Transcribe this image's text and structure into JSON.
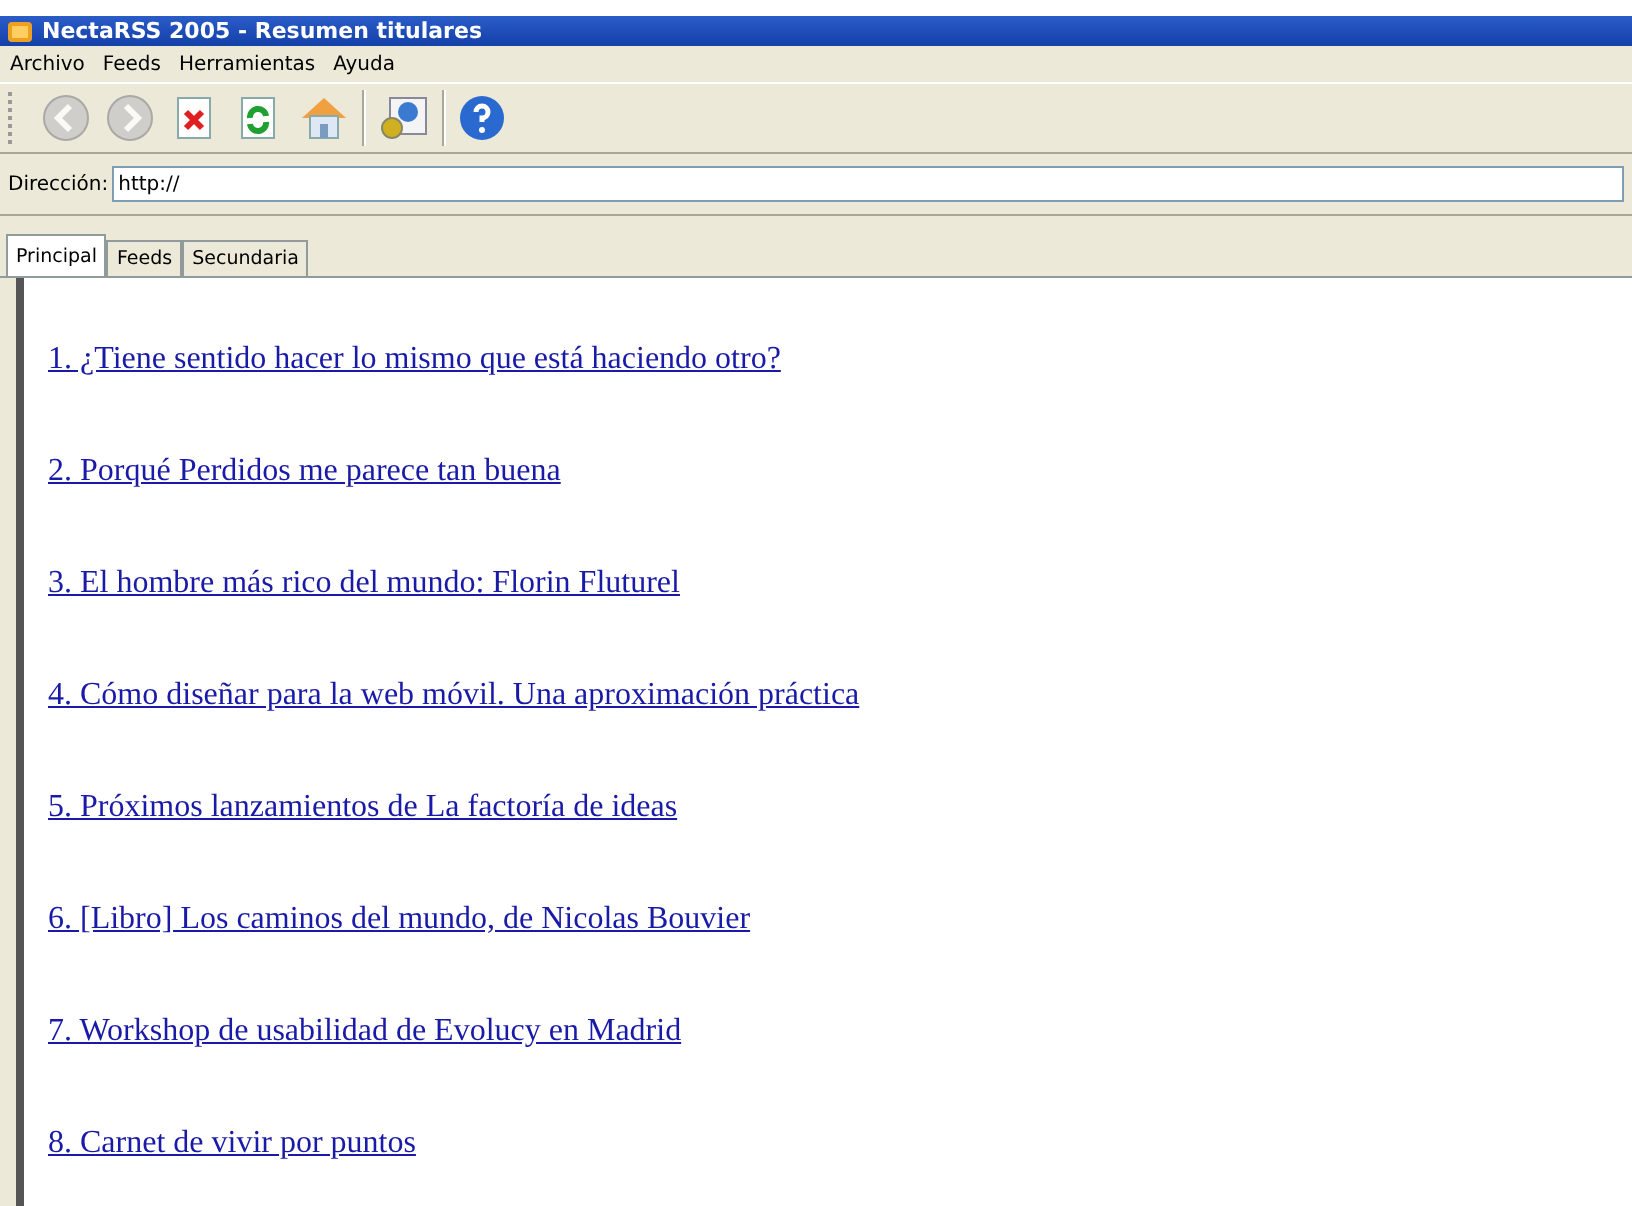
{
  "window": {
    "title": "NectaRSS 2005 - Resumen titulares"
  },
  "menu": [
    "Archivo",
    "Feeds",
    "Herramientas",
    "Ayuda"
  ],
  "toolbar": [
    {
      "kind": "back",
      "disabled": true
    },
    {
      "kind": "forward",
      "disabled": true
    },
    {
      "kind": "stop",
      "disabled": false
    },
    {
      "kind": "refresh",
      "disabled": false
    },
    {
      "kind": "home",
      "disabled": false
    },
    {
      "kind": "separator"
    },
    {
      "kind": "settings",
      "disabled": false
    },
    {
      "kind": "separator"
    },
    {
      "kind": "help",
      "disabled": false
    }
  ],
  "address": {
    "label": "Dirección:",
    "value": "http://"
  },
  "tabs": [
    {
      "label": "Principal",
      "selected": true
    },
    {
      "label": "Feeds",
      "selected": false
    },
    {
      "label": "Secundaria",
      "selected": false
    }
  ],
  "headlines": [
    "1. ¿Tiene sentido hacer lo mismo que está haciendo otro?",
    "2. Porqué Perdidos me parece tan buena",
    "3. El hombre más rico del mundo: Florin Fluturel",
    "4. Cómo diseñar para la web móvil. Una aproximación práctica",
    "5. Próximos lanzamientos de La factoría de ideas",
    "6. [Libro] Los caminos del mundo, de Nicolas Bouvier",
    "7. Workshop de usabilidad de Evolucy en Madrid",
    "8. Carnet de vivir por puntos"
  ]
}
